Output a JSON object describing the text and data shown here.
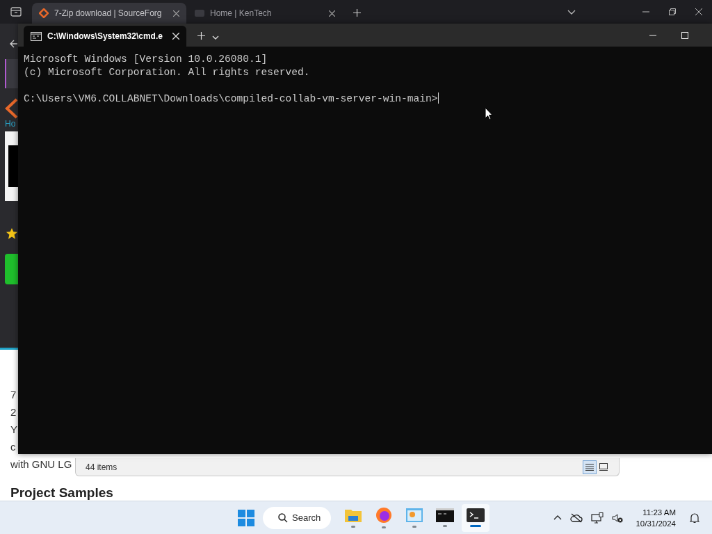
{
  "browser": {
    "tabs": [
      {
        "title": "7-Zip download | SourceForg",
        "selected": true
      },
      {
        "title": "Home | KenTech",
        "selected": false
      }
    ],
    "breadcrumb": "Ho",
    "page_texts": [
      "7",
      "2",
      "Y",
      "c",
      "with GNU LG"
    ],
    "heading": "Project Samples"
  },
  "explorer": {
    "status": "44 items",
    "views": [
      {
        "kind": "details",
        "selected": true
      },
      {
        "kind": "tiles",
        "selected": false
      }
    ]
  },
  "terminal": {
    "tab": "C:\\Windows\\System32\\cmd.e",
    "lines": [
      "Microsoft Windows [Version 10.0.26080.1]",
      "(c) Microsoft Corporation. All rights reserved."
    ],
    "prompt": "C:\\Users\\VM6.COLLABNET\\Downloads\\compiled-collab-vm-server-win-main>"
  },
  "taskbar": {
    "search": "Search",
    "apps": [
      {
        "kind": "files",
        "selected": false
      },
      {
        "kind": "firefox",
        "selected": false
      },
      {
        "kind": "control",
        "selected": false
      },
      {
        "kind": "cmd",
        "selected": false
      },
      {
        "kind": "terminal",
        "selected": true
      }
    ],
    "clock": {
      "time": "11:23 AM",
      "date": "10/31/2024"
    }
  }
}
